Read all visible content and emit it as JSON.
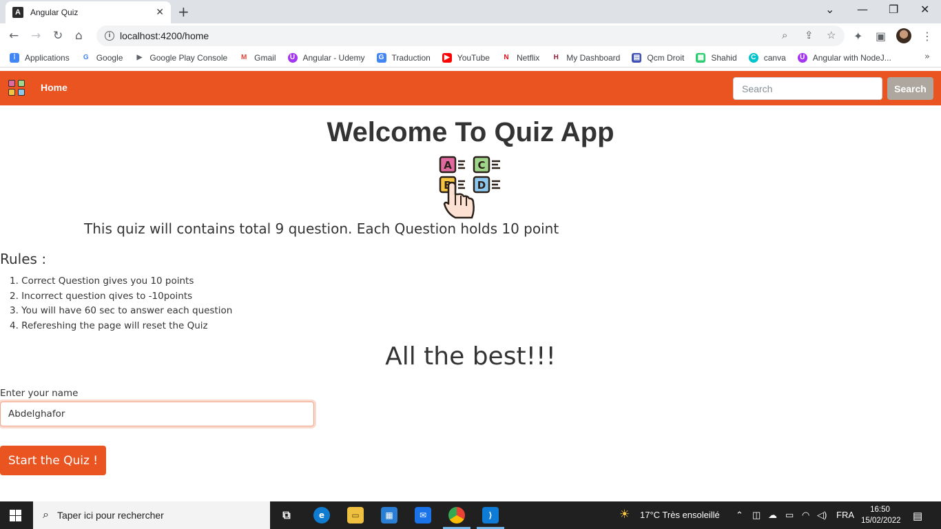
{
  "browser": {
    "tab_title": "Angular Quiz",
    "tab_icon": "A",
    "url": "localhost:4200/home",
    "bookmarks": [
      {
        "label": "Applications",
        "icon": "apps-grid-icon",
        "color": "#4285f4"
      },
      {
        "label": "Google",
        "icon": "google-icon",
        "color": "#4285f4"
      },
      {
        "label": "Google Play Console",
        "icon": "play-console-icon",
        "color": "#5f6368"
      },
      {
        "label": "Gmail",
        "icon": "gmail-icon",
        "color": "#ea4335"
      },
      {
        "label": "Angular -  Udemy",
        "icon": "udemy-icon",
        "color": "#a435f0"
      },
      {
        "label": "Traduction",
        "icon": "translate-icon",
        "color": "#4285f4"
      },
      {
        "label": "YouTube",
        "icon": "youtube-icon",
        "color": "#ff0000"
      },
      {
        "label": "Netflix",
        "icon": "netflix-icon",
        "color": "#e50914"
      },
      {
        "label": "My Dashboard",
        "icon": "dashboard-icon",
        "color": "#8e1b3a"
      },
      {
        "label": "Qcm Droit",
        "icon": "qcm-icon",
        "color": "#3f51b5"
      },
      {
        "label": "Shahid",
        "icon": "shahid-icon",
        "color": "#2ecc71"
      },
      {
        "label": "canva",
        "icon": "canva-icon",
        "color": "#00c4cc"
      },
      {
        "label": "Angular with NodeJ...",
        "icon": "udemy-icon",
        "color": "#a435f0"
      }
    ]
  },
  "navbar": {
    "home_label": "Home",
    "search_placeholder": "Search",
    "search_button": "Search",
    "accent": "#e95420"
  },
  "main": {
    "title": "Welcome To Quiz App",
    "intro": "This quiz will contains total 9 question. Each Question holds 10 point",
    "rules_title": "Rules :",
    "rules": [
      "1. Correct Question gives you 10 points",
      "2. Incorrect question qives to -10points",
      "3. You will have 60 sec to answer each question",
      "4. Refereshing the page will reset the Quiz"
    ],
    "best": "All the best!!!",
    "name_label": "Enter your name",
    "name_value": "Abdelghafor",
    "start_button": "Start the Quiz !"
  },
  "taskbar": {
    "search_placeholder": "Taper ici pour rechercher",
    "weather": "17°C  Très ensoleillé",
    "language": "FRA",
    "time": "16:50",
    "date": "15/02/2022"
  }
}
